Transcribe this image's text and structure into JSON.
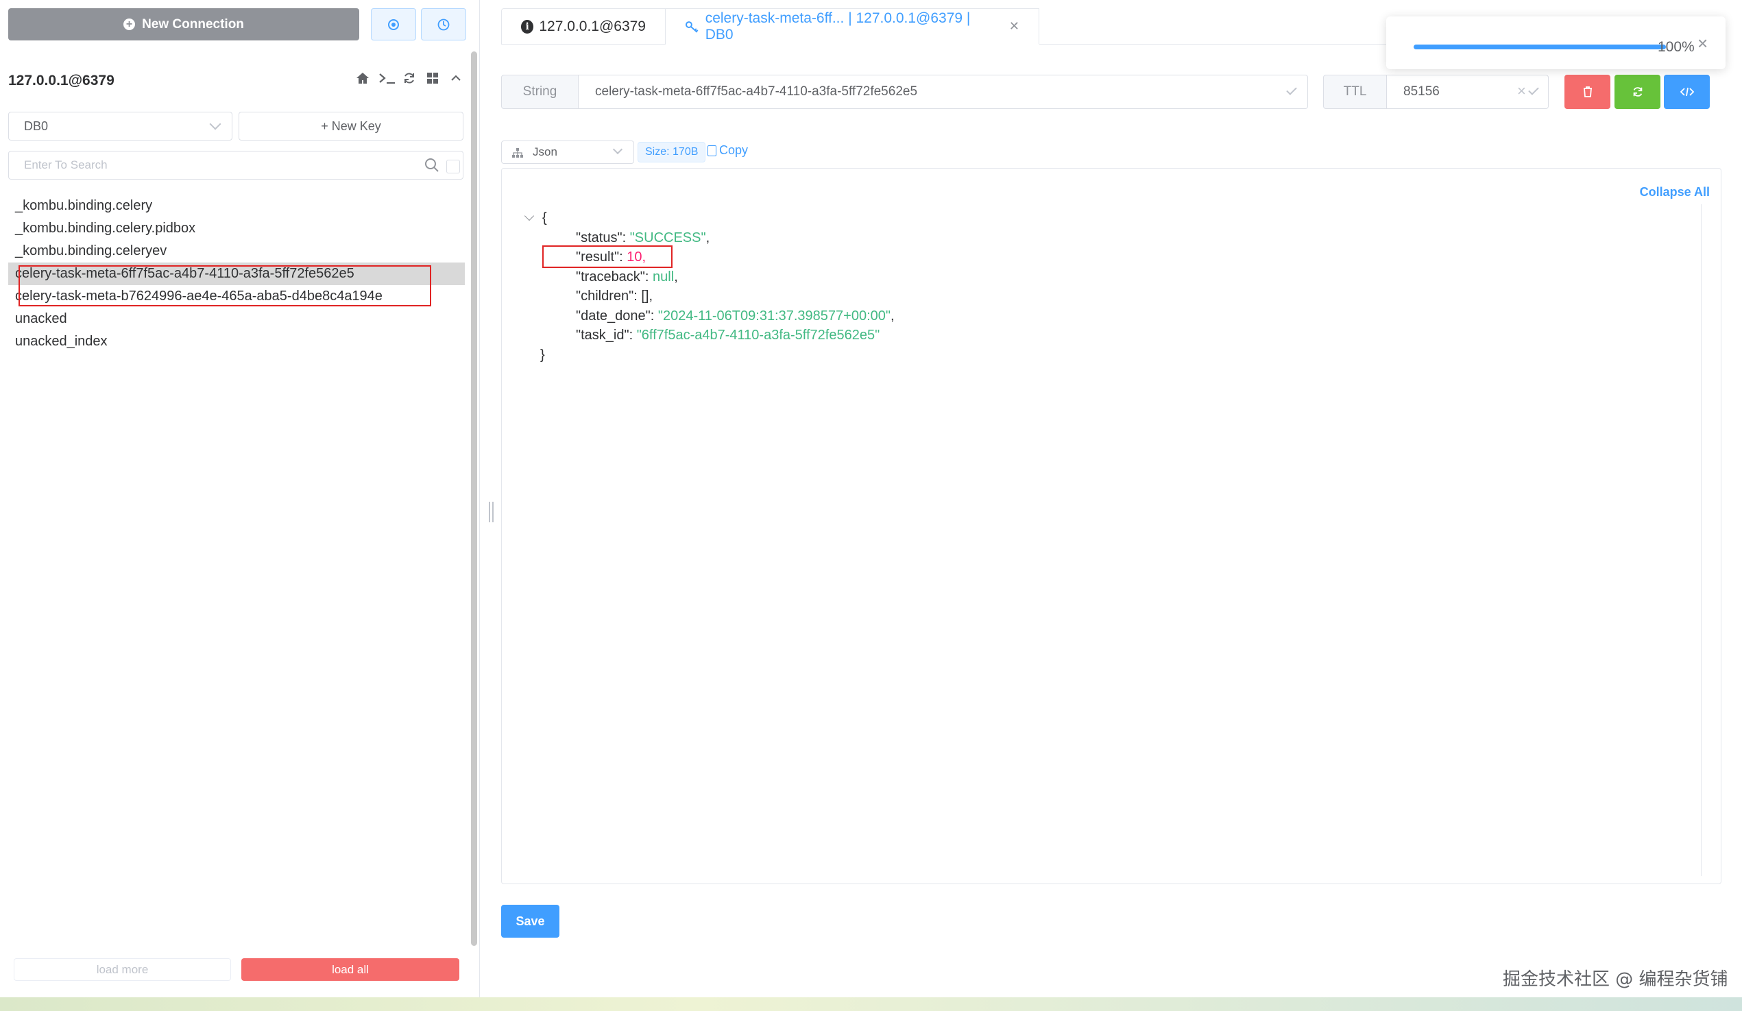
{
  "left": {
    "new_connection_label": "New Connection",
    "connection_title": "127.0.0.1@6379",
    "db_select": "DB0",
    "new_key_label": "+ New Key",
    "search_placeholder": "Enter To Search",
    "keys": [
      "_kombu.binding.celery",
      "_kombu.binding.celery.pidbox",
      "_kombu.binding.celeryev",
      "celery-task-meta-6ff7f5ac-a4b7-4110-a3fa-5ff72fe562e5",
      "celery-task-meta-b7624996-ae4e-465a-aba5-d4be8c4a194e",
      "unacked",
      "unacked_index"
    ],
    "active_key_index": 3,
    "load_more_label": "load more",
    "load_all_label": "load all"
  },
  "tabs": {
    "connection": "127.0.0.1@6379",
    "key": "celery-task-meta-6ff... | 127.0.0.1@6379 | DB0"
  },
  "key_header": {
    "type": "String",
    "name": "celery-task-meta-6ff7f5ac-a4b7-4110-a3fa-5ff72fe562e5",
    "ttl_label": "TTL",
    "ttl_value": "85156"
  },
  "viewer": {
    "format": "Json",
    "size": "Size: 170B",
    "copy_label": "Copy",
    "collapse_label": "Collapse All",
    "json": {
      "open": "{",
      "close": "}",
      "status_key": "\"status\"",
      "status_val": "\"SUCCESS\"",
      "result_key": "\"result\"",
      "result_val": "10",
      "traceback_key": "\"traceback\"",
      "traceback_val": "null",
      "children_key": "\"children\"",
      "children_val": "[]",
      "date_done_key": "\"date_done\"",
      "date_done_val": "\"2024-11-06T09:31:37.398577+00:00\"",
      "task_id_key": "\"task_id\"",
      "task_id_val": "\"6ff7f5ac-a4b7-4110-a3fa-5ff72fe562e5\""
    },
    "save_label": "Save"
  },
  "toast": {
    "progress_percent": 100,
    "progress_text": "100%"
  },
  "watermark": "掘金技术社区 @ 编程杂货铺",
  "colors": {
    "primary": "#409eff",
    "danger": "#f56c6c",
    "success": "#67c23a",
    "string": "#42b983",
    "number": "#fc1e70"
  }
}
